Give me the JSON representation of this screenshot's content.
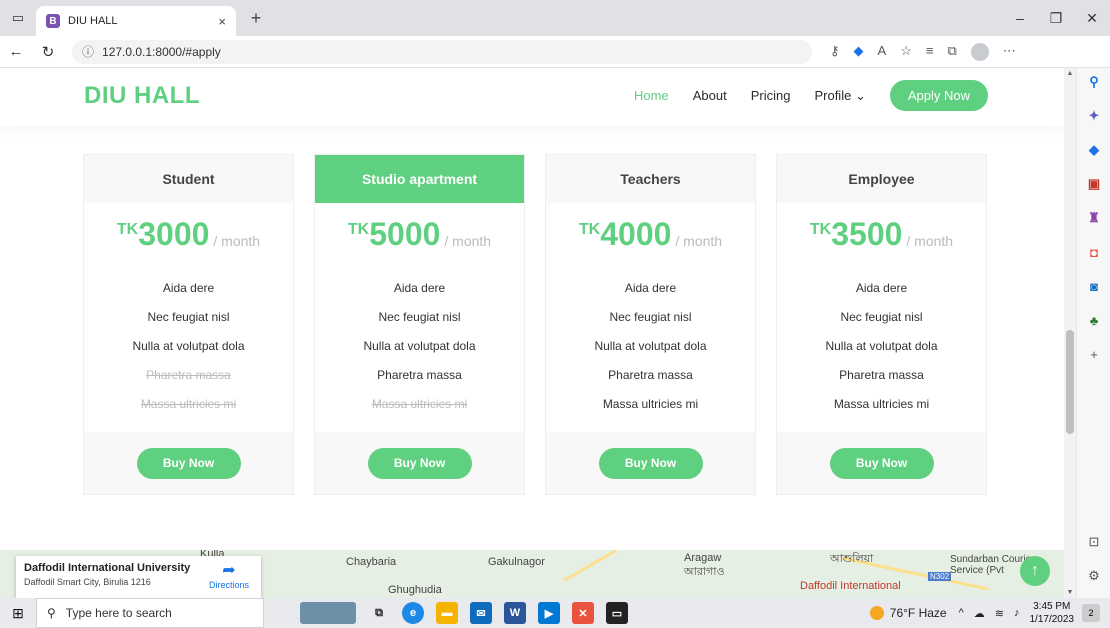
{
  "browser": {
    "tab_title": "DIU HALL",
    "tab_close": "×",
    "new_tab": "+",
    "url": "127.0.0.1:8000/#apply"
  },
  "site": {
    "logo": "DIU HALL",
    "nav": {
      "home": "Home",
      "about": "About",
      "pricing": "Pricing",
      "profile": "Profile",
      "apply": "Apply Now"
    }
  },
  "pricing": {
    "currency": "TK",
    "period": "/ month",
    "buy_label": "Buy Now",
    "plans": [
      {
        "name": "Student",
        "price": "3000",
        "features": [
          {
            "text": "Aida dere",
            "available": true
          },
          {
            "text": "Nec feugiat nisl",
            "available": true
          },
          {
            "text": "Nulla at volutpat dola",
            "available": true
          },
          {
            "text": "Pharetra massa",
            "available": false
          },
          {
            "text": "Massa ultricies mi",
            "available": false
          }
        ]
      },
      {
        "name": "Studio apartment",
        "featured": true,
        "price": "5000",
        "features": [
          {
            "text": "Aida dere",
            "available": true
          },
          {
            "text": "Nec feugiat nisl",
            "available": true
          },
          {
            "text": "Nulla at volutpat dola",
            "available": true
          },
          {
            "text": "Pharetra massa",
            "available": true
          },
          {
            "text": "Massa ultricies mi",
            "available": false
          }
        ]
      },
      {
        "name": "Teachers",
        "price": "4000",
        "features": [
          {
            "text": "Aida dere",
            "available": true
          },
          {
            "text": "Nec feugiat nisl",
            "available": true
          },
          {
            "text": "Nulla at volutpat dola",
            "available": true
          },
          {
            "text": "Pharetra massa",
            "available": true
          },
          {
            "text": "Massa ultricies mi",
            "available": true
          }
        ]
      },
      {
        "name": "Employee",
        "price": "3500",
        "features": [
          {
            "text": "Aida dere",
            "available": true
          },
          {
            "text": "Nec feugiat nisl",
            "available": true
          },
          {
            "text": "Nulla at volutpat dola",
            "available": true
          },
          {
            "text": "Pharetra massa",
            "available": true
          },
          {
            "text": "Massa ultricies mi",
            "available": true
          }
        ]
      }
    ]
  },
  "map": {
    "place_name": "Daffodil International University",
    "place_address": "Daffodil Smart City, Birulia 1216",
    "directions": "Directions",
    "labels": [
      "Kulla",
      "Chaybaria",
      "Gakulnagor",
      "Ghughudia",
      "Aragaw",
      "আরাগাও",
      "আশুলিয়া",
      "Daffodil International",
      "Sundarban Courier Service (Pvt",
      "N302"
    ]
  },
  "taskbar": {
    "search_placeholder": "Type here to search",
    "weather": "76°F Haze",
    "time": "3:45 PM",
    "date": "1/17/2023",
    "notifications": "2"
  },
  "colors": {
    "accent": "#5fcf80",
    "text": "#333333",
    "muted": "#bbbbbb"
  }
}
